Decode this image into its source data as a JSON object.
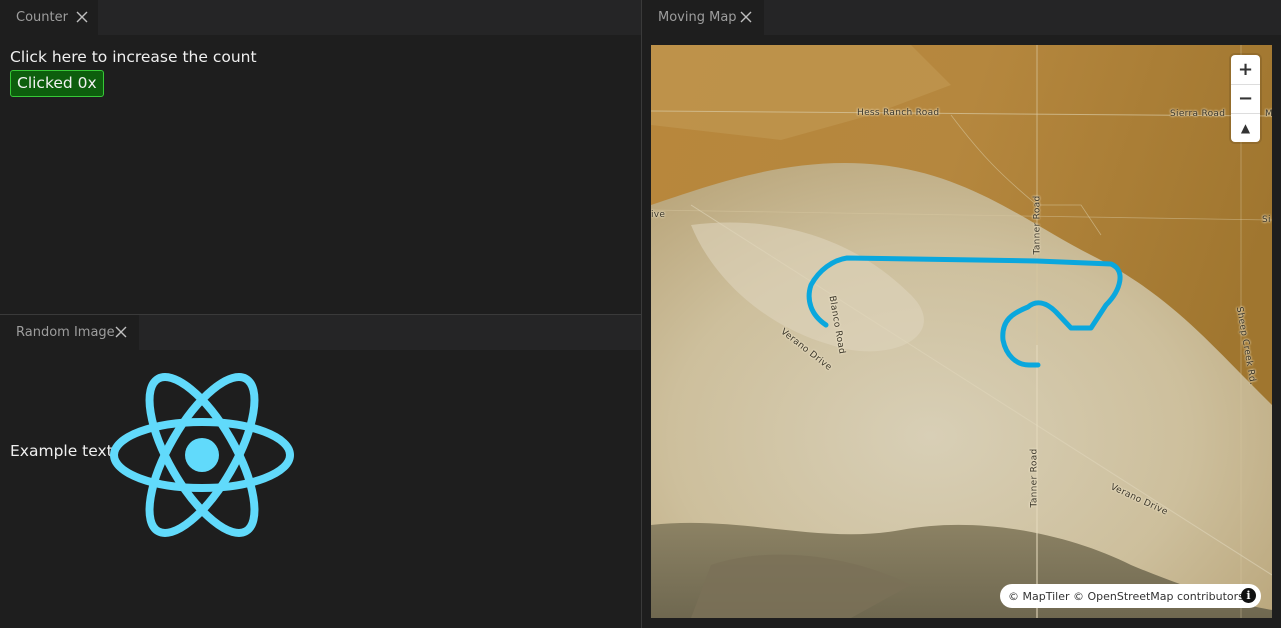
{
  "panels": {
    "counter": {
      "tab_label": "Counter",
      "prompt": "Click here to increase the count",
      "button_label": "Clicked 0x"
    },
    "random_image": {
      "tab_label": "Random Image",
      "example_text": "Example text"
    },
    "moving_map": {
      "tab_label": "Moving Map",
      "roads": {
        "hess_ranch": "Hess Ranch Road",
        "sierra": "Sierra Road",
        "tanner_top": "Tanner Road",
        "tanner_bottom": "Tanner Road",
        "blanco": "Blanco Road",
        "verano_left": "Verano Drive",
        "verano_right": "Verano Drive",
        "sheep_creek": "Sheep Creek Rd.",
        "edge_left": "ive",
        "edge_right_top": "M",
        "edge_right_mid": "Si"
      },
      "controls": {
        "zoom_in": "+",
        "zoom_out": "−",
        "compass": "▲"
      },
      "attribution": "© MapTiler © OpenStreetMap contributors",
      "info_icon": "i",
      "track_color": "#0aa7dd"
    }
  },
  "colors": {
    "accent_button_bg": "#0d5e0d",
    "accent_button_border": "#37c837",
    "react_blue": "#61dafb"
  }
}
